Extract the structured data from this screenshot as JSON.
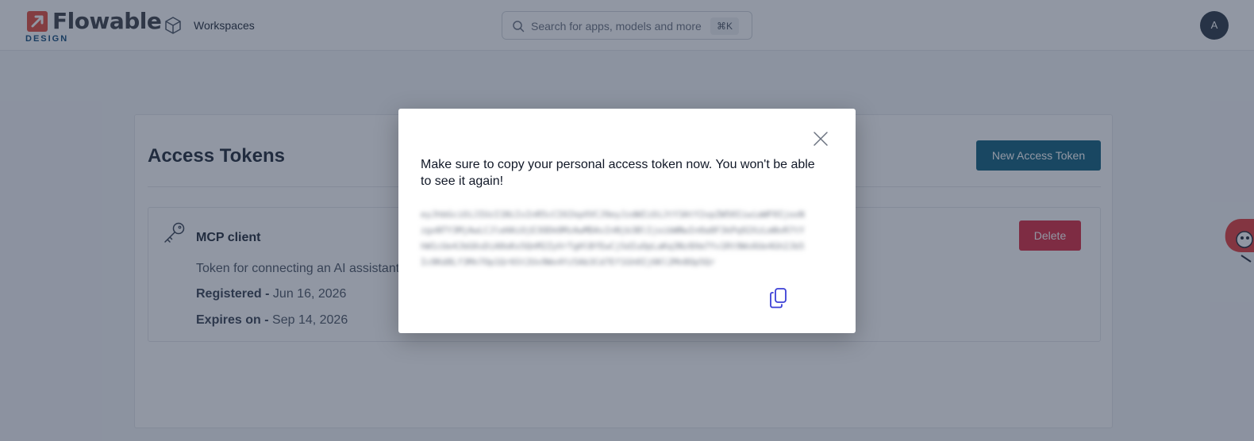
{
  "topbar": {
    "logo_text": "Flowable",
    "logo_subtitle": "DESIGN",
    "workspaces_label": "Workspaces",
    "search_placeholder": "Search for apps, models and more",
    "search_shortcut": "⌘K",
    "avatar_initial": "A"
  },
  "page": {
    "title": "Access Tokens",
    "new_token_button": "New Access Token",
    "tokens": [
      {
        "name": "MCP client",
        "description": "Token for connecting an AI assistant",
        "registered_label": "Registered -",
        "registered_date": "Jun 16, 2026",
        "expires_label": "Expires on -",
        "expires_date": "Sep 14, 2026",
        "delete_button": "Delete"
      }
    ]
  },
  "modal": {
    "message": "Make sure to copy your personal access token now. You won't be able to see it again!",
    "token_value": "eyJhbGciOiJIUzI1NiIsInR5cCI6IkpXVCJ9eyJzdWIiOiJtY3AtY2xpZW50IiwiaWF0IjoxNzgxNTY3MjAwLCJleHAiOjE3ODk0MzAwMDAsInNjb3BlIjoibWNwIn0a8F3kPq92XzLmNvR7tYhW1cUe4JbG6sDiA0oKx5QnM2ZyVrTgHlBfEwCjSdIuOpLaKq3Nz8Xm7Yv1Rt9Ws6Ue4Gh2Jb5Ic0Kd8Lf3Mn7Op1Qr6St2Uv9Wx4Yz5Ab3Cd7Ef1Gh0Ij6Kl2Mn8Op5Qr"
  },
  "colors": {
    "primary": "#0f5f7d",
    "danger": "#d8283e",
    "brand": "#e24a3b",
    "overlay": "rgba(35,47,72,0.5)"
  },
  "icons": {
    "logo": "flowable-logo-icon",
    "workspaces": "cube-icon",
    "search": "search-icon",
    "token": "key-icon",
    "close": "close-icon",
    "copy": "copy-icon"
  }
}
